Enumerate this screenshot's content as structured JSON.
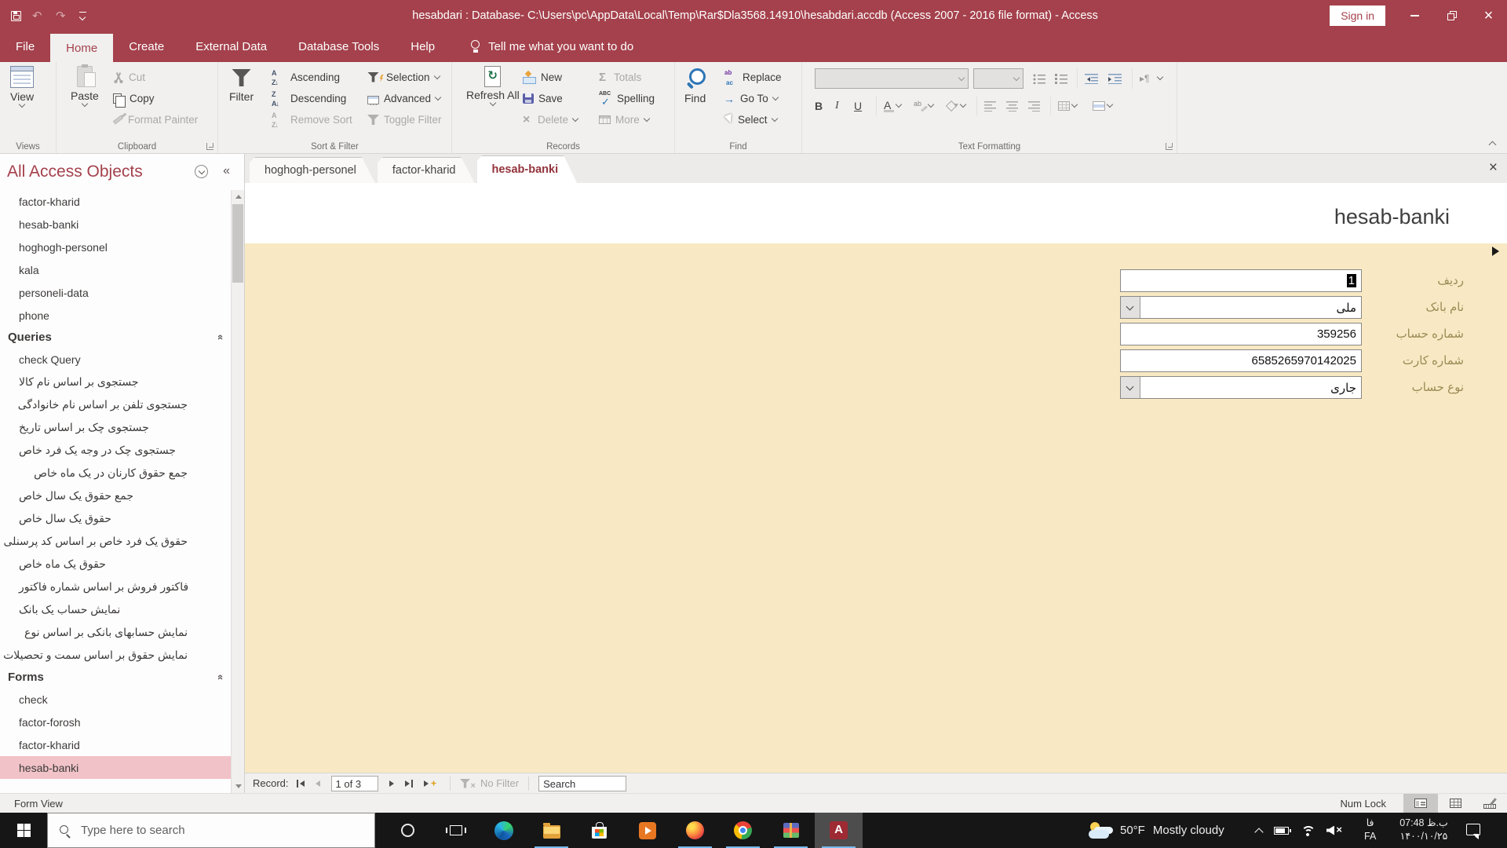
{
  "titlebar": {
    "title": "hesabdari : Database- C:\\Users\\pc\\AppData\\Local\\Temp\\Rar$Dla3568.14910\\hesabdari.accdb (Access 2007 - 2016 file format)  -  Access",
    "sign_in": "Sign in"
  },
  "ribbon_tabs": {
    "file": "File",
    "home": "Home",
    "create": "Create",
    "external_data": "External Data",
    "database_tools": "Database Tools",
    "help": "Help",
    "tell_me": "Tell me what you want to do"
  },
  "ribbon": {
    "views": {
      "label": "Views",
      "view": "View"
    },
    "clipboard": {
      "label": "Clipboard",
      "paste": "Paste",
      "cut": "Cut",
      "copy": "Copy",
      "format_painter": "Format Painter"
    },
    "sort_filter": {
      "label": "Sort & Filter",
      "filter": "Filter",
      "ascending": "Ascending",
      "descending": "Descending",
      "remove_sort": "Remove Sort",
      "selection": "Selection",
      "advanced": "Advanced",
      "toggle_filter": "Toggle Filter"
    },
    "records": {
      "label": "Records",
      "refresh_all": "Refresh All",
      "new": "New",
      "save": "Save",
      "delete": "Delete",
      "totals": "Totals",
      "spelling": "Spelling",
      "more": "More"
    },
    "find": {
      "label": "Find",
      "find": "Find",
      "replace": "Replace",
      "go_to": "Go To",
      "select": "Select"
    },
    "text_formatting": {
      "label": "Text Formatting"
    }
  },
  "nav": {
    "title": "All Access Objects",
    "tables": [
      "factor-kharid",
      "hesab-banki",
      "hoghogh-personel",
      "kala",
      "personeli-data",
      "phone"
    ],
    "queries_header": "Queries",
    "queries": [
      {
        "label": "check Query",
        "rtl": false
      },
      {
        "label": "جستجوی بر اساس نام کالا",
        "rtl": false
      },
      {
        "label": "جستجوی تلفن بر اساس نام خانوادگی",
        "rtl": true
      },
      {
        "label": "جستجوی چک بر اساس تاریخ",
        "rtl": false
      },
      {
        "label": "جستجوی چک در وجه یک فرد خاص",
        "rtl": false
      },
      {
        "label": "جمع حقوق کارنان در یک ماه خاص",
        "rtl": true
      },
      {
        "label": "جمع حقوق یک سال خاص",
        "rtl": false
      },
      {
        "label": "حقوق یک سال خاص",
        "rtl": false
      },
      {
        "label": "حقوق یک فرد خاص بر اساس کد پرسنلی",
        "rtl": true
      },
      {
        "label": "حقوق یک ماه خاص",
        "rtl": false
      },
      {
        "label": "فاکتور فروش بر اساس شماره فاکتور",
        "rtl": false
      },
      {
        "label": "نمایش حساب یک بانک",
        "rtl": false
      },
      {
        "label": "نمایش حسابهای بانکی بر اساس نوع",
        "rtl": true
      },
      {
        "label": "نمایش حقوق بر اساس سمت و تحصیلات",
        "rtl": true
      }
    ],
    "forms_header": "Forms",
    "forms": [
      "check",
      "factor-forosh",
      "factor-kharid",
      "hesab-banki"
    ],
    "selected_form": "hesab-banki",
    "forms_partial_row": true
  },
  "doc_tabs": [
    {
      "label": "hoghogh-personel",
      "icon": "table",
      "active": false
    },
    {
      "label": "factor-kharid",
      "icon": "form",
      "active": false
    },
    {
      "label": "hesab-banki",
      "icon": "form",
      "active": true
    }
  ],
  "form": {
    "title": "hesab-banki",
    "fields": [
      {
        "label": "ردیف",
        "value": "1",
        "type": "text",
        "selected": true
      },
      {
        "label": "نام بانک",
        "value": "ملی",
        "type": "combo",
        "selected": false
      },
      {
        "label": "شماره حساب",
        "value": "359256",
        "type": "text",
        "selected": false
      },
      {
        "label": "شماره کارت",
        "value": "6585265970142025",
        "type": "text",
        "selected": false
      },
      {
        "label": "نوع حساب",
        "value": "جاری",
        "type": "combo",
        "selected": false
      }
    ]
  },
  "record_bar": {
    "record_label": "Record:",
    "position": "1 of 3",
    "no_filter": "No Filter",
    "search": "Search"
  },
  "status_bar": {
    "view_name": "Form View",
    "num_lock": "Num Lock"
  },
  "taskbar": {
    "search_placeholder": "Type here to search",
    "weather_temp": "50°F",
    "weather_desc": "Mostly cloudy",
    "lang_line1": "فا",
    "lang_line2": "FA",
    "time": "07:48 ب.ظ",
    "date": "۱۴۰۰/۱۰/۲۵"
  },
  "colors": {
    "accent_red": "#A4414C",
    "form_bg": "#F8E9C4",
    "selection_pink": "#F1C2C7"
  }
}
